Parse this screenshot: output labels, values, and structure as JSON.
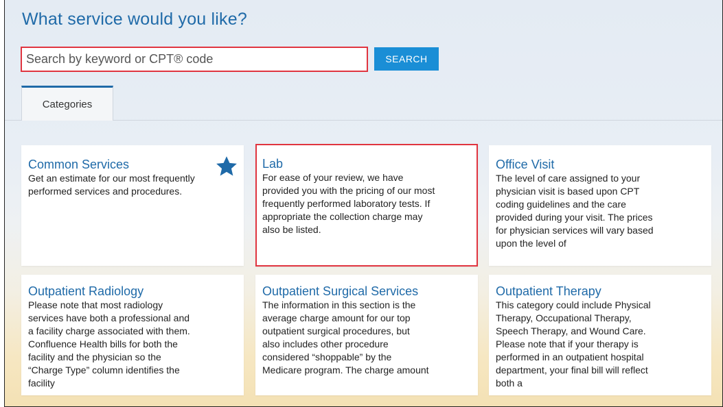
{
  "page": {
    "title": "What service would you like?"
  },
  "search": {
    "placeholder": "Search by keyword or CPT® code",
    "button_label": "SEARCH"
  },
  "tabs": [
    {
      "label": "Categories"
    }
  ],
  "colors": {
    "accent": "#1f6aa8",
    "button": "#1a8ed6",
    "highlight": "#e0343f"
  },
  "cards": [
    {
      "title": "Common Services",
      "description": "Get an estimate for our most frequently performed services and procedures.",
      "icon": "star-icon"
    },
    {
      "title": "Lab",
      "description": "For ease of your review, we have provided you with the pricing of our most frequently performed laboratory tests. If appropriate the collection charge may also be listed."
    },
    {
      "title": "Office Visit",
      "description": "The level of care assigned to your physician visit is based upon CPT coding guidelines and the care provided during your visit. The prices for physician services will vary based upon the level of"
    },
    {
      "title": "Outpatient Radiology",
      "description": "Please note that most radiology services have both a professional and a facility charge associated with them. Confluence Health bills for both the facility and the physician so the “Charge Type” column identifies the facility"
    },
    {
      "title": "Outpatient Surgical Services",
      "description": "The information in this section is the average charge amount for our top outpatient surgical procedures, but also includes other procedure considered “shoppable” by the Medicare program. The charge amount"
    },
    {
      "title": "Outpatient Therapy",
      "description": "This category could include Physical Therapy, Occupational Therapy, Speech Therapy, and Wound Care. Please note that if your therapy is performed in an outpatient hospital department, your final bill will reflect both a"
    }
  ]
}
